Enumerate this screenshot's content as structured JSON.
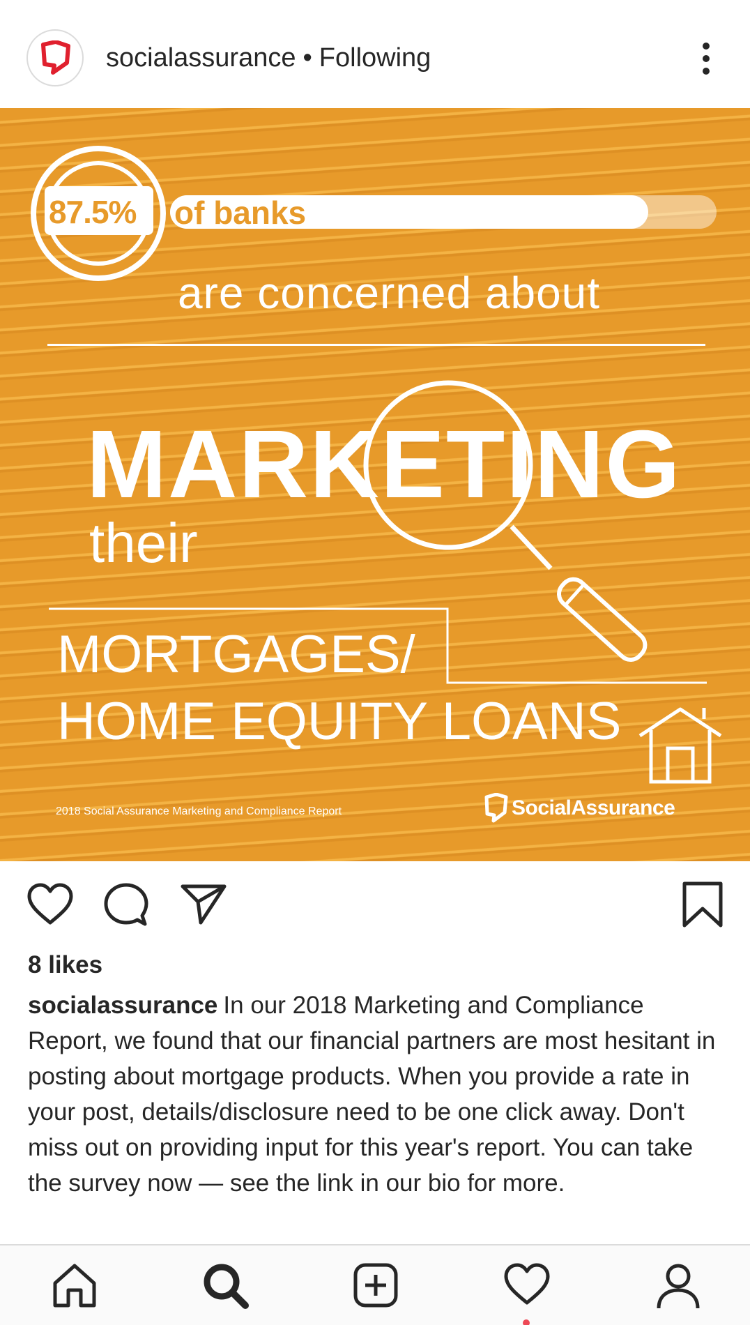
{
  "header": {
    "username": "socialassurance",
    "separator": "•",
    "follow_status": "Following"
  },
  "post_image": {
    "stat_percent": "87.5%",
    "stat_progress_fraction": 0.875,
    "stat_label": "of banks",
    "line_concern": "are concerned about",
    "headline": "MARKETING",
    "line_their": "their",
    "line_mortgages": "MORTGAGES/",
    "line_home_equity": "HOME EQUITY LOANS",
    "report_caption": "2018 Social Assurance Marketing and Compliance Report",
    "brand_name": "SocialAssurance",
    "background_color": "#e79a2a"
  },
  "actions": {
    "like_icon": "heart-outline-icon",
    "comment_icon": "comment-bubble-icon",
    "share_icon": "paper-plane-icon",
    "save_icon": "bookmark-icon"
  },
  "likes": "8 likes",
  "caption": {
    "username": "socialassurance",
    "text": "In our 2018 Marketing and Compliance Report, we found that our financial partners are most hesitant in posting about mortgage products. When you provide a rate in your post, details/disclosure need to be one click away. Don't miss out on providing input for this year's report. You can take the survey now — see the link in our bio for more."
  },
  "bottom_nav": {
    "items": [
      "home-icon",
      "search-icon",
      "new-post-icon",
      "activity-heart-icon",
      "profile-icon"
    ],
    "active": "search-icon",
    "notification_color": "#ed4956"
  }
}
